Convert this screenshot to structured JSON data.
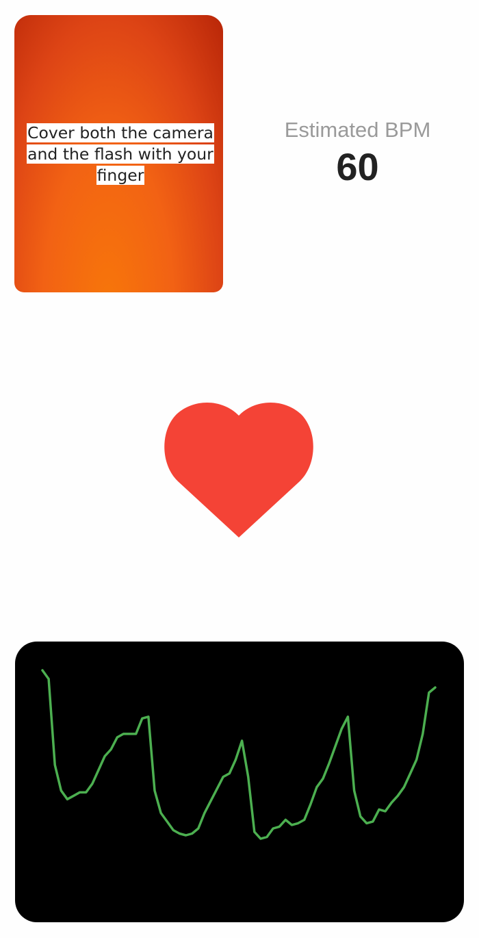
{
  "camera": {
    "hint": "Cover both the camera and the flash with your finger"
  },
  "bpm": {
    "label": "Estimated BPM",
    "value": "60"
  },
  "heart": {
    "icon": "heart-icon",
    "color": "#F44336"
  },
  "graph": {
    "line_color": "#4CAF50",
    "background": "#000000",
    "samples": [
      0.85,
      0.8,
      0.3,
      0.15,
      0.1,
      0.12,
      0.14,
      0.14,
      0.19,
      0.27,
      0.35,
      0.39,
      0.46,
      0.48,
      0.48,
      0.48,
      0.57,
      0.58,
      0.15,
      0.02,
      -0.03,
      -0.08,
      -0.1,
      -0.11,
      -0.1,
      -0.07,
      0.02,
      0.09,
      0.16,
      0.23,
      0.25,
      0.33,
      0.44,
      0.23,
      -0.09,
      -0.13,
      -0.12,
      -0.07,
      -0.06,
      -0.02,
      -0.05,
      -0.04,
      -0.02,
      0.07,
      0.17,
      0.22,
      0.31,
      0.41,
      0.51,
      0.58,
      0.15,
      0.0,
      -0.04,
      -0.03,
      0.04,
      0.03,
      0.08,
      0.12,
      0.17,
      0.25,
      0.33,
      0.48,
      0.72,
      0.75
    ]
  }
}
